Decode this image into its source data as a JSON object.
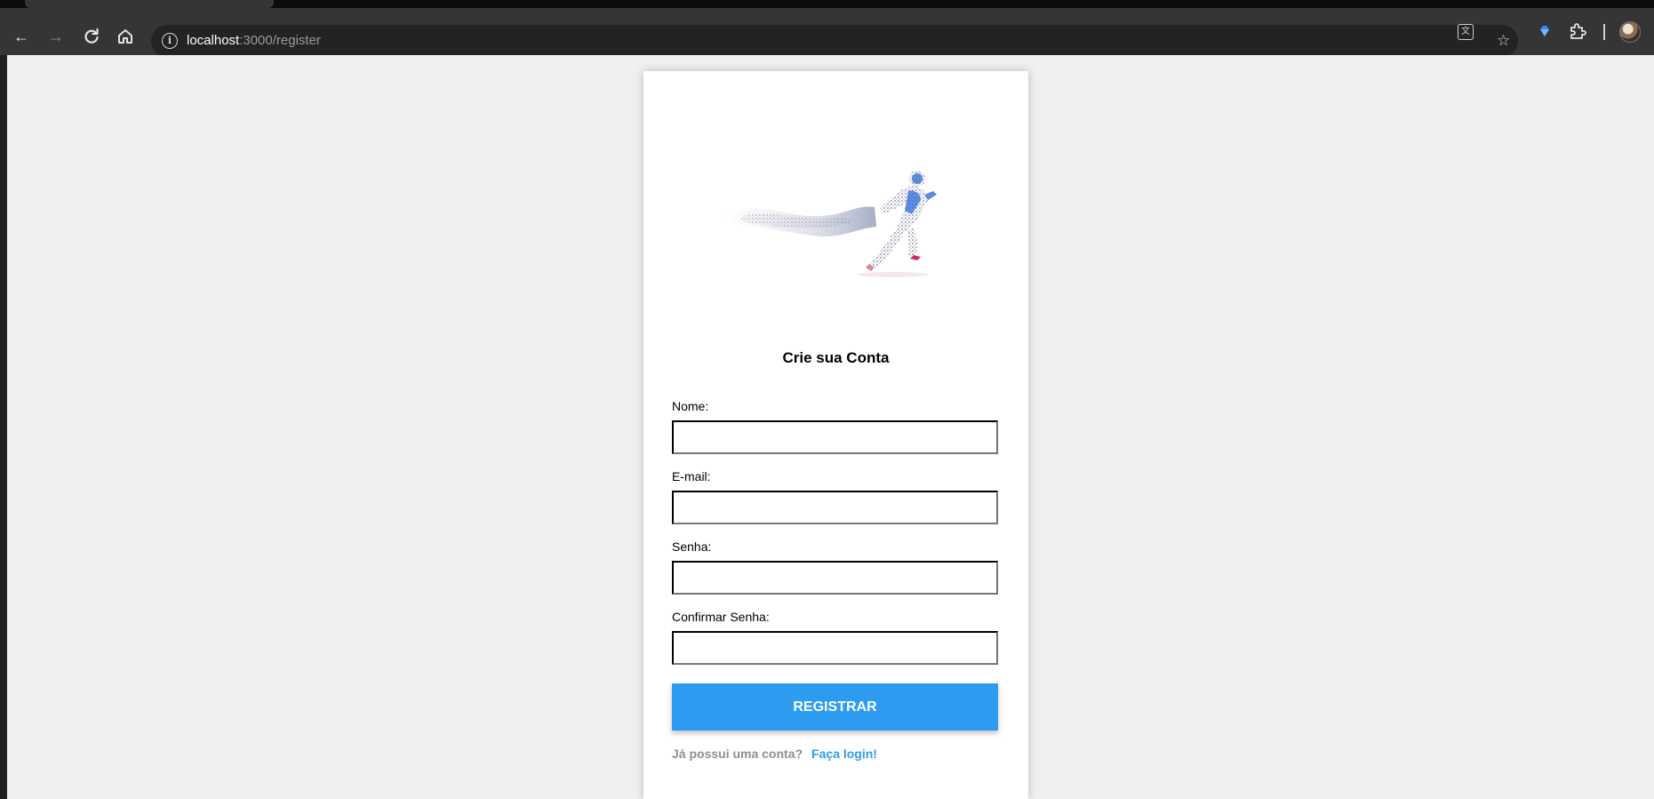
{
  "browser": {
    "url_host": "localhost",
    "url_path": ":3000/register",
    "icons": [
      "back-arrow-icon",
      "forward-arrow-icon",
      "reload-icon",
      "home-icon",
      "site-info-icon",
      "translate-icon",
      "bookmark-star-icon",
      "extension-gem-icon",
      "extensions-puzzle-icon",
      "profile-avatar"
    ]
  },
  "form": {
    "title": "Crie sua Conta",
    "fields": [
      {
        "label": "Nome:",
        "value": ""
      },
      {
        "label": "E-mail:",
        "value": ""
      },
      {
        "label": "Senha:",
        "value": ""
      },
      {
        "label": "Confirmar Senha:",
        "value": ""
      }
    ],
    "submit_label": "REGISTRAR",
    "login_prompt": "Já possui uma conta?",
    "login_link": "Faça login!"
  },
  "colors": {
    "accent": "#2d9cf0",
    "page_bg": "#f0f0f0",
    "card_bg": "#ffffff",
    "browser_toolbar": "#353535"
  }
}
